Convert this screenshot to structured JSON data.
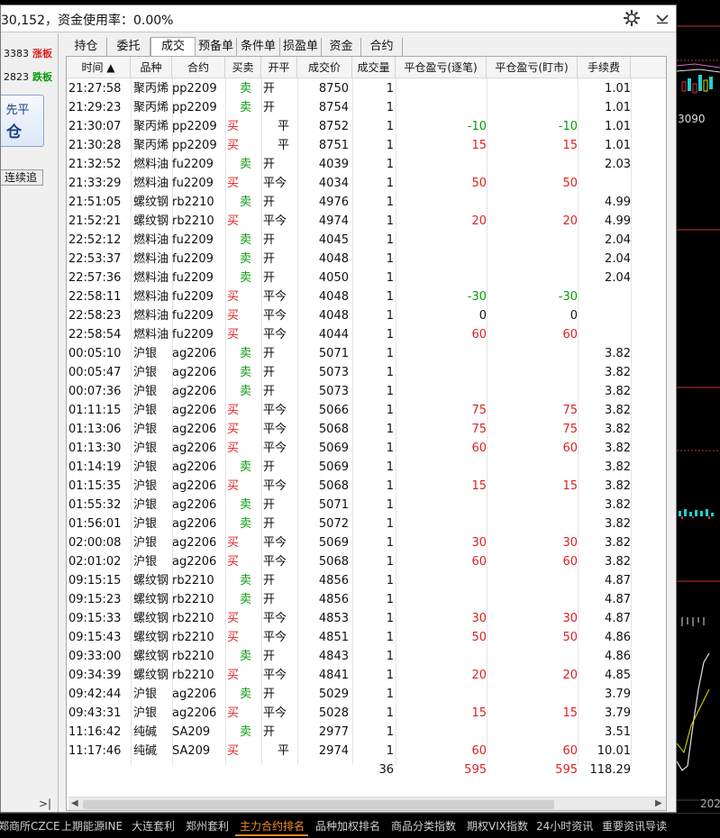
{
  "window": {
    "title": "30,152，资金使用率：0.00%"
  },
  "left_panel": {
    "quotes": [
      {
        "value": "3383",
        "limit": "涨板"
      },
      {
        "value": "2823",
        "limit": "跌板"
      }
    ],
    "close_button": {
      "line1": "先平",
      "line2": "仓"
    },
    "continuous_button": "连续追",
    "scroll_label": ">|"
  },
  "tabs": [
    "持仓",
    "委托",
    "成交",
    "预备单",
    "条件单",
    "损盈单",
    "资金",
    "合约"
  ],
  "table": {
    "headers": [
      "时间 ▲",
      "品种",
      "合约",
      "买卖",
      "开平",
      "成交价",
      "成交量",
      "平仓盈亏(逐笔)",
      "平仓盈亏(盯市)",
      "手续费"
    ],
    "rows": [
      [
        "21:27:58",
        "聚丙烯",
        "pp2209",
        "卖",
        "开",
        "8750",
        "1",
        "",
        "",
        "1.01"
      ],
      [
        "21:29:23",
        "聚丙烯",
        "pp2209",
        "卖",
        "开",
        "8754",
        "1",
        "",
        "",
        "1.01"
      ],
      [
        "21:30:07",
        "聚丙烯",
        "pp2209",
        "买",
        "平",
        "8752",
        "1",
        "-10",
        "-10",
        "1.01"
      ],
      [
        "21:30:28",
        "聚丙烯",
        "pp2209",
        "买",
        "平",
        "8751",
        "1",
        "15",
        "15",
        "1.01"
      ],
      [
        "21:32:52",
        "燃料油",
        "fu2209",
        "卖",
        "开",
        "4039",
        "1",
        "",
        "",
        "2.03"
      ],
      [
        "21:33:29",
        "燃料油",
        "fu2209",
        "买",
        "平今",
        "4034",
        "1",
        "50",
        "50",
        ""
      ],
      [
        "21:51:05",
        "螺纹钢",
        "rb2210",
        "卖",
        "开",
        "4976",
        "1",
        "",
        "",
        "4.99"
      ],
      [
        "21:52:21",
        "螺纹钢",
        "rb2210",
        "买",
        "平今",
        "4974",
        "1",
        "20",
        "20",
        "4.99"
      ],
      [
        "22:52:12",
        "燃料油",
        "fu2209",
        "卖",
        "开",
        "4045",
        "1",
        "",
        "",
        "2.04"
      ],
      [
        "22:53:37",
        "燃料油",
        "fu2209",
        "卖",
        "开",
        "4048",
        "1",
        "",
        "",
        "2.04"
      ],
      [
        "22:57:36",
        "燃料油",
        "fu2209",
        "卖",
        "开",
        "4050",
        "1",
        "",
        "",
        "2.04"
      ],
      [
        "22:58:11",
        "燃料油",
        "fu2209",
        "买",
        "平今",
        "4048",
        "1",
        "-30",
        "-30",
        ""
      ],
      [
        "22:58:23",
        "燃料油",
        "fu2209",
        "买",
        "平今",
        "4048",
        "1",
        "0",
        "0",
        ""
      ],
      [
        "22:58:54",
        "燃料油",
        "fu2209",
        "买",
        "平今",
        "4044",
        "1",
        "60",
        "60",
        ""
      ],
      [
        "00:05:10",
        "沪银",
        "ag2206",
        "卖",
        "开",
        "5071",
        "1",
        "",
        "",
        "3.82"
      ],
      [
        "00:05:47",
        "沪银",
        "ag2206",
        "卖",
        "开",
        "5073",
        "1",
        "",
        "",
        "3.82"
      ],
      [
        "00:07:36",
        "沪银",
        "ag2206",
        "卖",
        "开",
        "5073",
        "1",
        "",
        "",
        "3.82"
      ],
      [
        "01:11:15",
        "沪银",
        "ag2206",
        "买",
        "平今",
        "5066",
        "1",
        "75",
        "75",
        "3.82"
      ],
      [
        "01:13:06",
        "沪银",
        "ag2206",
        "买",
        "平今",
        "5068",
        "1",
        "75",
        "75",
        "3.82"
      ],
      [
        "01:13:30",
        "沪银",
        "ag2206",
        "买",
        "平今",
        "5069",
        "1",
        "60",
        "60",
        "3.82"
      ],
      [
        "01:14:19",
        "沪银",
        "ag2206",
        "卖",
        "开",
        "5069",
        "1",
        "",
        "",
        "3.82"
      ],
      [
        "01:15:35",
        "沪银",
        "ag2206",
        "买",
        "平今",
        "5068",
        "1",
        "15",
        "15",
        "3.82"
      ],
      [
        "01:55:32",
        "沪银",
        "ag2206",
        "卖",
        "开",
        "5071",
        "1",
        "",
        "",
        "3.82"
      ],
      [
        "01:56:01",
        "沪银",
        "ag2206",
        "卖",
        "开",
        "5072",
        "1",
        "",
        "",
        "3.82"
      ],
      [
        "02:00:08",
        "沪银",
        "ag2206",
        "买",
        "平今",
        "5069",
        "1",
        "30",
        "30",
        "3.82"
      ],
      [
        "02:01:02",
        "沪银",
        "ag2206",
        "买",
        "平今",
        "5068",
        "1",
        "60",
        "60",
        "3.82"
      ],
      [
        "09:15:15",
        "螺纹钢",
        "rb2210",
        "卖",
        "开",
        "4856",
        "1",
        "",
        "",
        "4.87"
      ],
      [
        "09:15:23",
        "螺纹钢",
        "rb2210",
        "卖",
        "开",
        "4856",
        "1",
        "",
        "",
        "4.87"
      ],
      [
        "09:15:33",
        "螺纹钢",
        "rb2210",
        "买",
        "平今",
        "4853",
        "1",
        "30",
        "30",
        "4.87"
      ],
      [
        "09:15:43",
        "螺纹钢",
        "rb2210",
        "买",
        "平今",
        "4851",
        "1",
        "50",
        "50",
        "4.86"
      ],
      [
        "09:33:00",
        "螺纹钢",
        "rb2210",
        "卖",
        "开",
        "4843",
        "1",
        "",
        "",
        "4.86"
      ],
      [
        "09:34:39",
        "螺纹钢",
        "rb2210",
        "买",
        "平今",
        "4841",
        "1",
        "20",
        "20",
        "4.85"
      ],
      [
        "09:42:44",
        "沪银",
        "ag2206",
        "卖",
        "开",
        "5029",
        "1",
        "",
        "",
        "3.79"
      ],
      [
        "09:43:31",
        "沪银",
        "ag2206",
        "买",
        "平今",
        "5028",
        "1",
        "15",
        "15",
        "3.79"
      ],
      [
        "11:16:42",
        "纯碱",
        "SA209",
        "卖",
        "开",
        "2977",
        "1",
        "",
        "",
        "3.51"
      ],
      [
        "11:17:46",
        "纯碱",
        "SA209",
        "买",
        "平",
        "2974",
        "1",
        "60",
        "60",
        "10.01"
      ]
    ],
    "totals": {
      "volume": "36",
      "pnl_trade": "595",
      "pnl_mtm": "595",
      "fee": "118.29"
    }
  },
  "bottom_tabs": [
    "郑商所CZCE",
    "上期能源INE",
    "大连套利",
    "郑州套利",
    "主力合约排名",
    "品种加权排名",
    "商品分类指数",
    "期权VIX指数",
    "24小时资讯",
    "重要资讯导读"
  ],
  "bottom_active": "主力合约排名",
  "right_chart": {
    "price_label": "3090",
    "year_label": "202"
  },
  "colors": {
    "sell": "#0a9a0a",
    "buy": "#e02020",
    "profit": "#e02020",
    "loss": "#0a9a0a",
    "active_tab": "#f28c28"
  }
}
